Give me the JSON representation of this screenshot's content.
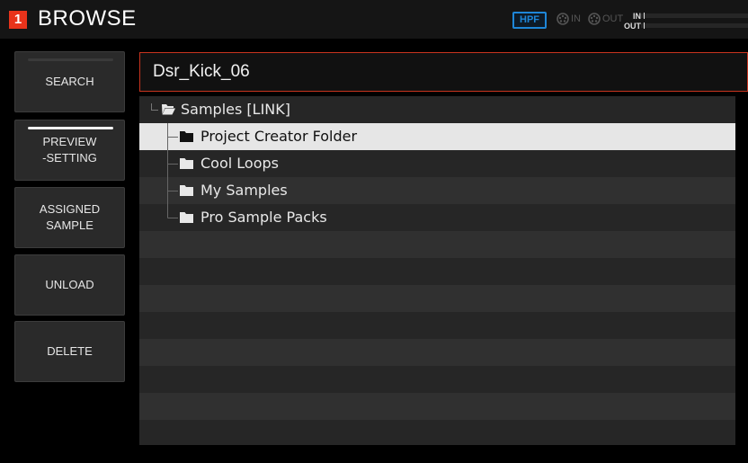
{
  "header": {
    "track_number": "1",
    "title": "BROWSE",
    "hpf_label": "HPF",
    "midi_in_label": "IN",
    "midi_out_label": "OUT",
    "meter_in_label": "IN",
    "meter_out_label": "OUT"
  },
  "sidebar": {
    "buttons": [
      {
        "label": "SEARCH",
        "active": false
      },
      {
        "label": "PREVIEW\n-SETTING",
        "active": true
      },
      {
        "label": "ASSIGNED\nSAMPLE",
        "active": false
      },
      {
        "label": "UNLOAD",
        "active": false
      },
      {
        "label": "DELETE",
        "active": false
      }
    ]
  },
  "main": {
    "name_value": "Dsr_Kick_06",
    "tree": {
      "root": {
        "label": "Samples [LINK]",
        "icon": "folder-open-icon"
      },
      "children": [
        {
          "label": "Project Creator Folder",
          "icon": "folder-icon",
          "selected": true
        },
        {
          "label": "Cool Loops",
          "icon": "folder-icon",
          "selected": false
        },
        {
          "label": "My Samples",
          "icon": "folder-icon",
          "selected": false
        },
        {
          "label": "Pro Sample Packs",
          "icon": "folder-icon",
          "selected": false
        }
      ]
    }
  },
  "colors": {
    "accent_red": "#e8331b",
    "hpf_blue": "#1e86d8",
    "selection": "#e6e6e6"
  }
}
